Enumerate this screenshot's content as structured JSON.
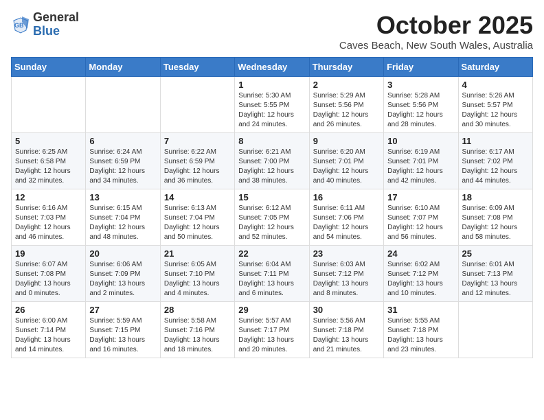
{
  "logo": {
    "general": "General",
    "blue": "Blue"
  },
  "header": {
    "month": "October 2025",
    "subtitle": "Caves Beach, New South Wales, Australia"
  },
  "weekdays": [
    "Sunday",
    "Monday",
    "Tuesday",
    "Wednesday",
    "Thursday",
    "Friday",
    "Saturday"
  ],
  "weeks": [
    [
      {
        "day": "",
        "info": ""
      },
      {
        "day": "",
        "info": ""
      },
      {
        "day": "",
        "info": ""
      },
      {
        "day": "1",
        "info": "Sunrise: 5:30 AM\nSunset: 5:55 PM\nDaylight: 12 hours\nand 24 minutes."
      },
      {
        "day": "2",
        "info": "Sunrise: 5:29 AM\nSunset: 5:56 PM\nDaylight: 12 hours\nand 26 minutes."
      },
      {
        "day": "3",
        "info": "Sunrise: 5:28 AM\nSunset: 5:56 PM\nDaylight: 12 hours\nand 28 minutes."
      },
      {
        "day": "4",
        "info": "Sunrise: 5:26 AM\nSunset: 5:57 PM\nDaylight: 12 hours\nand 30 minutes."
      }
    ],
    [
      {
        "day": "5",
        "info": "Sunrise: 6:25 AM\nSunset: 6:58 PM\nDaylight: 12 hours\nand 32 minutes."
      },
      {
        "day": "6",
        "info": "Sunrise: 6:24 AM\nSunset: 6:59 PM\nDaylight: 12 hours\nand 34 minutes."
      },
      {
        "day": "7",
        "info": "Sunrise: 6:22 AM\nSunset: 6:59 PM\nDaylight: 12 hours\nand 36 minutes."
      },
      {
        "day": "8",
        "info": "Sunrise: 6:21 AM\nSunset: 7:00 PM\nDaylight: 12 hours\nand 38 minutes."
      },
      {
        "day": "9",
        "info": "Sunrise: 6:20 AM\nSunset: 7:01 PM\nDaylight: 12 hours\nand 40 minutes."
      },
      {
        "day": "10",
        "info": "Sunrise: 6:19 AM\nSunset: 7:01 PM\nDaylight: 12 hours\nand 42 minutes."
      },
      {
        "day": "11",
        "info": "Sunrise: 6:17 AM\nSunset: 7:02 PM\nDaylight: 12 hours\nand 44 minutes."
      }
    ],
    [
      {
        "day": "12",
        "info": "Sunrise: 6:16 AM\nSunset: 7:03 PM\nDaylight: 12 hours\nand 46 minutes."
      },
      {
        "day": "13",
        "info": "Sunrise: 6:15 AM\nSunset: 7:04 PM\nDaylight: 12 hours\nand 48 minutes."
      },
      {
        "day": "14",
        "info": "Sunrise: 6:13 AM\nSunset: 7:04 PM\nDaylight: 12 hours\nand 50 minutes."
      },
      {
        "day": "15",
        "info": "Sunrise: 6:12 AM\nSunset: 7:05 PM\nDaylight: 12 hours\nand 52 minutes."
      },
      {
        "day": "16",
        "info": "Sunrise: 6:11 AM\nSunset: 7:06 PM\nDaylight: 12 hours\nand 54 minutes."
      },
      {
        "day": "17",
        "info": "Sunrise: 6:10 AM\nSunset: 7:07 PM\nDaylight: 12 hours\nand 56 minutes."
      },
      {
        "day": "18",
        "info": "Sunrise: 6:09 AM\nSunset: 7:08 PM\nDaylight: 12 hours\nand 58 minutes."
      }
    ],
    [
      {
        "day": "19",
        "info": "Sunrise: 6:07 AM\nSunset: 7:08 PM\nDaylight: 13 hours\nand 0 minutes."
      },
      {
        "day": "20",
        "info": "Sunrise: 6:06 AM\nSunset: 7:09 PM\nDaylight: 13 hours\nand 2 minutes."
      },
      {
        "day": "21",
        "info": "Sunrise: 6:05 AM\nSunset: 7:10 PM\nDaylight: 13 hours\nand 4 minutes."
      },
      {
        "day": "22",
        "info": "Sunrise: 6:04 AM\nSunset: 7:11 PM\nDaylight: 13 hours\nand 6 minutes."
      },
      {
        "day": "23",
        "info": "Sunrise: 6:03 AM\nSunset: 7:12 PM\nDaylight: 13 hours\nand 8 minutes."
      },
      {
        "day": "24",
        "info": "Sunrise: 6:02 AM\nSunset: 7:12 PM\nDaylight: 13 hours\nand 10 minutes."
      },
      {
        "day": "25",
        "info": "Sunrise: 6:01 AM\nSunset: 7:13 PM\nDaylight: 13 hours\nand 12 minutes."
      }
    ],
    [
      {
        "day": "26",
        "info": "Sunrise: 6:00 AM\nSunset: 7:14 PM\nDaylight: 13 hours\nand 14 minutes."
      },
      {
        "day": "27",
        "info": "Sunrise: 5:59 AM\nSunset: 7:15 PM\nDaylight: 13 hours\nand 16 minutes."
      },
      {
        "day": "28",
        "info": "Sunrise: 5:58 AM\nSunset: 7:16 PM\nDaylight: 13 hours\nand 18 minutes."
      },
      {
        "day": "29",
        "info": "Sunrise: 5:57 AM\nSunset: 7:17 PM\nDaylight: 13 hours\nand 20 minutes."
      },
      {
        "day": "30",
        "info": "Sunrise: 5:56 AM\nSunset: 7:18 PM\nDaylight: 13 hours\nand 21 minutes."
      },
      {
        "day": "31",
        "info": "Sunrise: 5:55 AM\nSunset: 7:18 PM\nDaylight: 13 hours\nand 23 minutes."
      },
      {
        "day": "",
        "info": ""
      }
    ]
  ]
}
